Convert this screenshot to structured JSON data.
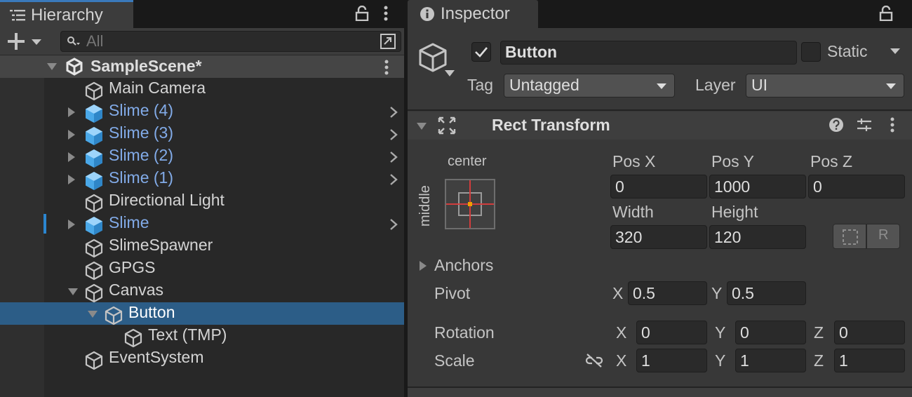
{
  "hierarchy": {
    "tab_label": "Hierarchy",
    "search_placeholder": "All",
    "scene": {
      "label": "SampleScene*"
    },
    "items": [
      {
        "label": "Main Camera",
        "depth": 0,
        "prefab": false,
        "expandable": false,
        "expanded": false
      },
      {
        "label": "Slime (4)",
        "depth": 0,
        "prefab": true,
        "expandable": true,
        "expanded": false
      },
      {
        "label": "Slime (3)",
        "depth": 0,
        "prefab": true,
        "expandable": true,
        "expanded": false
      },
      {
        "label": "Slime (2)",
        "depth": 0,
        "prefab": true,
        "expandable": true,
        "expanded": false
      },
      {
        "label": "Slime (1)",
        "depth": 0,
        "prefab": true,
        "expandable": true,
        "expanded": false
      },
      {
        "label": "Directional Light",
        "depth": 0,
        "prefab": false,
        "expandable": false,
        "expanded": false
      },
      {
        "label": "Slime",
        "depth": 0,
        "prefab": true,
        "expandable": true,
        "expanded": false,
        "marked": true
      },
      {
        "label": "SlimeSpawner",
        "depth": 0,
        "prefab": false,
        "expandable": false,
        "expanded": false
      },
      {
        "label": "GPGS",
        "depth": 0,
        "prefab": false,
        "expandable": false,
        "expanded": false
      },
      {
        "label": "Canvas",
        "depth": 0,
        "prefab": false,
        "expandable": true,
        "expanded": true
      },
      {
        "label": "Button",
        "depth": 1,
        "prefab": false,
        "expandable": true,
        "expanded": true,
        "selected": true
      },
      {
        "label": "Text (TMP)",
        "depth": 2,
        "prefab": false,
        "expandable": false,
        "expanded": false
      },
      {
        "label": "EventSystem",
        "depth": 0,
        "prefab": false,
        "expandable": false,
        "expanded": false
      }
    ]
  },
  "inspector": {
    "tab_label": "Inspector",
    "object_name": "Button",
    "static_label": "Static",
    "tag_label": "Tag",
    "tag_value": "Untagged",
    "layer_label": "Layer",
    "layer_value": "UI",
    "rect_transform": {
      "title": "Rect Transform",
      "anchor_h": "center",
      "anchor_v": "middle",
      "pos_x_label": "Pos X",
      "pos_y_label": "Pos Y",
      "pos_z_label": "Pos Z",
      "pos_x": "0",
      "pos_y": "1000",
      "pos_z": "0",
      "width_label": "Width",
      "height_label": "Height",
      "width": "320",
      "height": "120",
      "raw_button": "R",
      "anchors_label": "Anchors",
      "pivot_label": "Pivot",
      "pivot_x": "0.5",
      "pivot_y": "0.5",
      "rotation_label": "Rotation",
      "rotation": {
        "x": "0",
        "y": "0",
        "z": "0"
      },
      "scale_label": "Scale",
      "scale": {
        "x": "1",
        "y": "1",
        "z": "1"
      },
      "axis_x": "X",
      "axis_y": "Y",
      "axis_z": "Z"
    }
  },
  "colors": {
    "selection": "#2c5d87",
    "prefab_text": "#82abe8",
    "tab_accent": "#3a79bb",
    "anchor_red": "#d23c3c",
    "anchor_orange": "#f0a000"
  }
}
